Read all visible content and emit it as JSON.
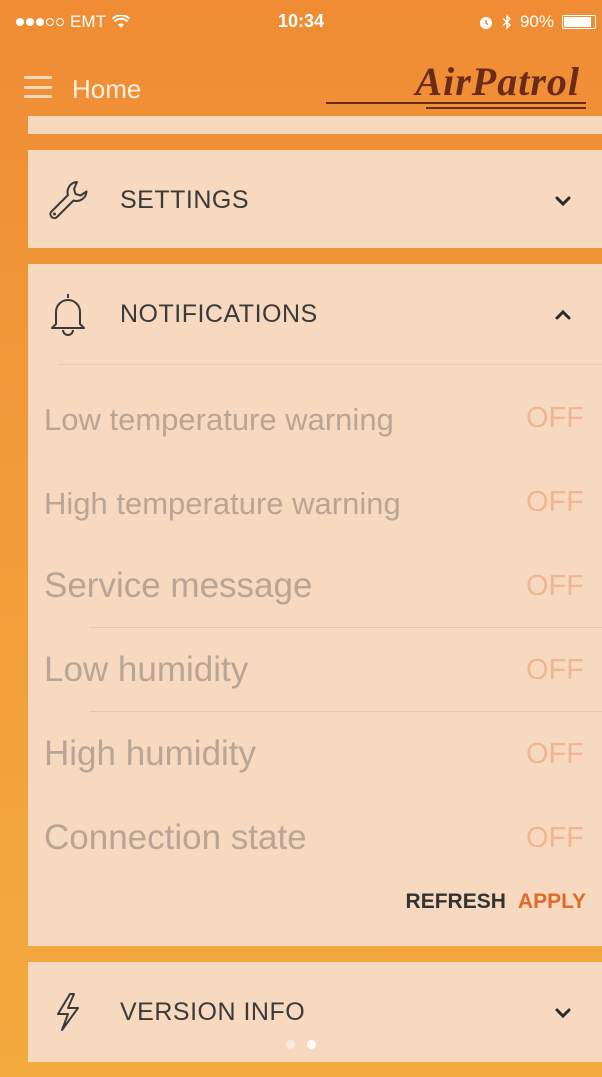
{
  "status_bar": {
    "carrier": "EMT",
    "time": "10:34",
    "battery": "90%",
    "battery_level": 0.9,
    "icons": [
      "signal-dots-icon",
      "wifi-icon",
      "alarm-icon",
      "bluetooth-icon",
      "battery-icon"
    ]
  },
  "nav": {
    "title": "Home",
    "logo_text": "AirPatrol",
    "menu_icon": "hamburger-icon"
  },
  "sections": {
    "settings": {
      "title": "SETTINGS",
      "icon": "wrench-icon",
      "expanded": false
    },
    "notifications": {
      "title": "NOTIFICATIONS",
      "icon": "bell-icon",
      "expanded": true
    },
    "version": {
      "title": "VERSION INFO",
      "icon": "lightning-icon",
      "expanded": false
    }
  },
  "notifications": {
    "items": [
      {
        "label": "Low temperature warning",
        "value": "OFF"
      },
      {
        "label": "High temperature warning",
        "value": "OFF"
      },
      {
        "label": "Service message",
        "value": "OFF"
      },
      {
        "label": "Low humidity",
        "value": "OFF"
      },
      {
        "label": "High humidity",
        "value": "OFF"
      },
      {
        "label": "Connection state",
        "value": "OFF"
      }
    ],
    "refresh_label": "REFRESH",
    "apply_label": "APPLY"
  },
  "pager": {
    "count": 2,
    "active_index": 1
  },
  "colors": {
    "background": "#f19a3a",
    "card": "#f7d9bf",
    "apply": "#e06a2a",
    "off_value": "#f0b691",
    "logo": "#6b2a1a"
  }
}
